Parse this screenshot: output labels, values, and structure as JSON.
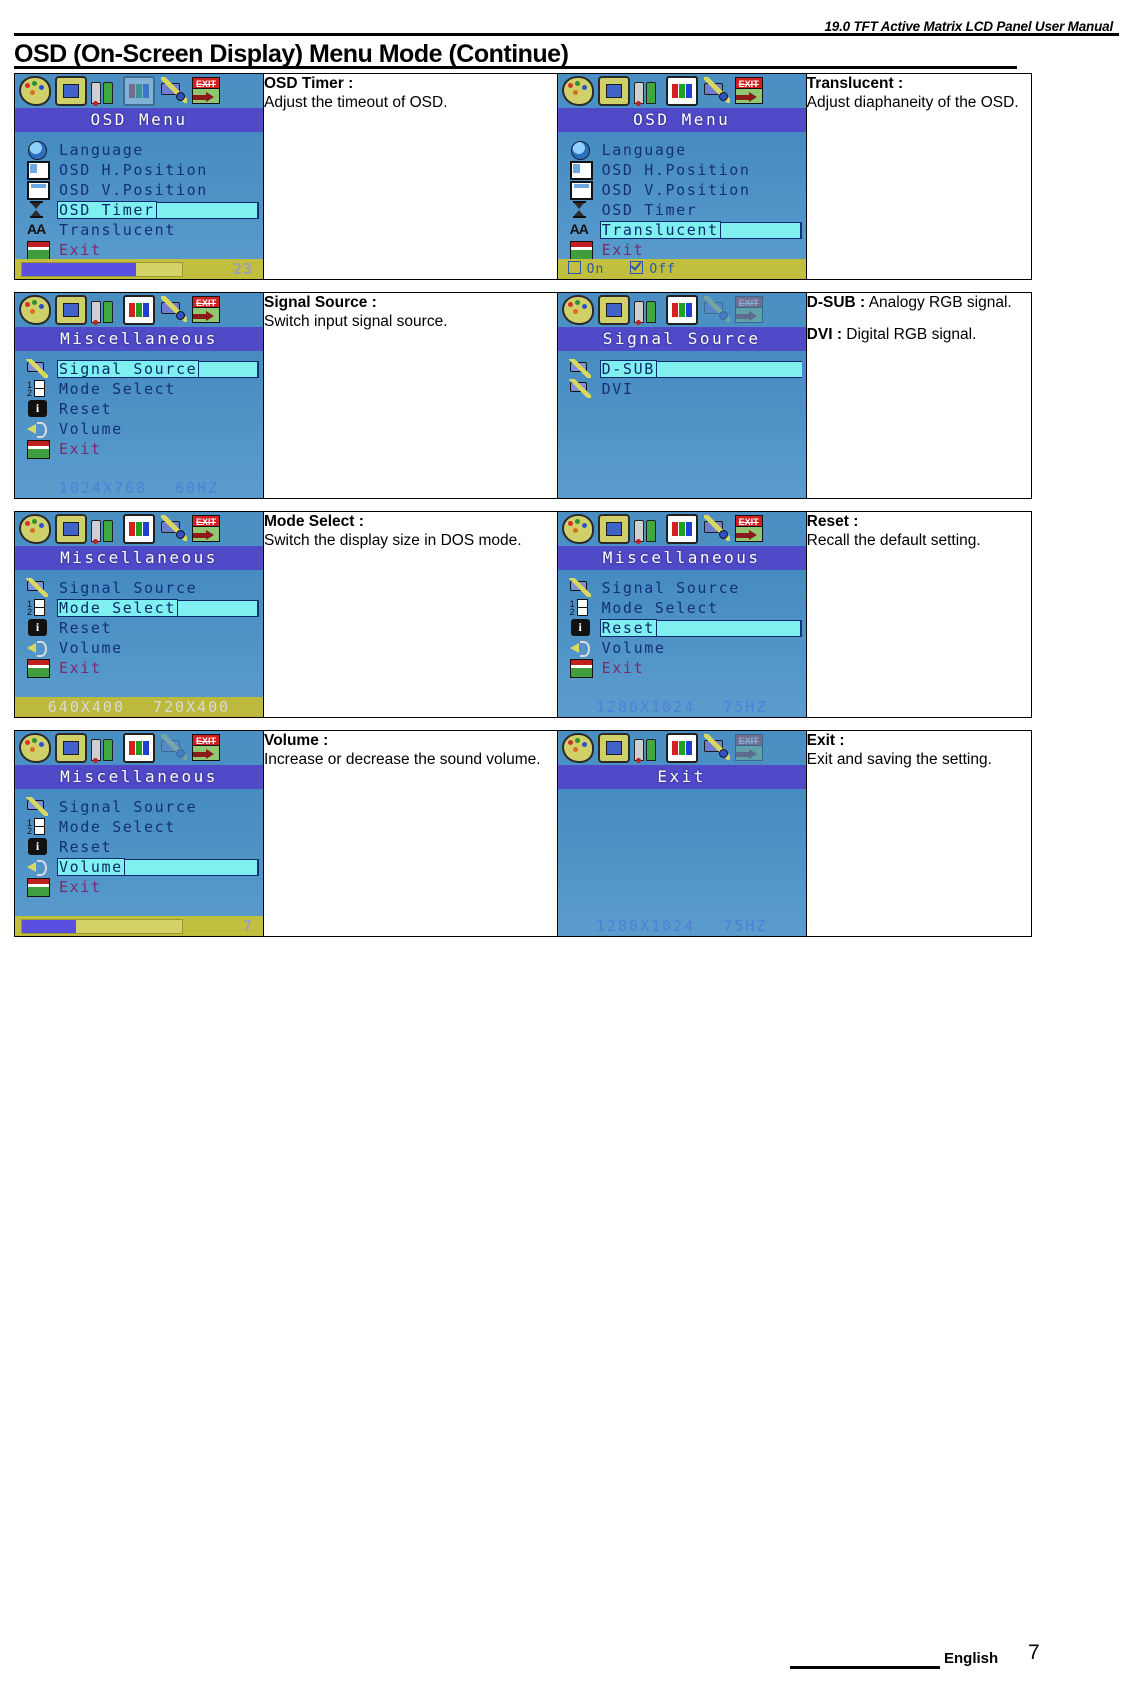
{
  "header": {
    "running_title": "19.0 TFT Active Matrix LCD Panel User Manual",
    "page_title": "OSD (On-Screen Display) Menu Mode (Continue)"
  },
  "footer": {
    "language": "English",
    "page_number": "7"
  },
  "osd_menu_labels": {
    "language": "Language",
    "osd_h_position": "OSD H.Position",
    "osd_v_position": "OSD V.Position",
    "osd_timer": "OSD Timer",
    "translucent": "Translucent",
    "exit": "Exit",
    "signal_source": "Signal Source",
    "mode_select": "Mode Select",
    "reset": "Reset",
    "volume": "Volume",
    "d_sub": "D-SUB",
    "dvi": "DVI"
  },
  "screen_titles": {
    "osd_menu": "OSD Menu",
    "miscellaneous": "Miscellaneous",
    "signal_source": "Signal Source",
    "exit": "Exit"
  },
  "rows": [
    {
      "left": {
        "title": "OSD Menu",
        "selected": "OSD Timer",
        "bottom_type": "progress",
        "progress_percent": 71,
        "value": "23"
      },
      "left_desc": {
        "term": "OSD Timer :",
        "text": "Adjust the timeout of OSD."
      },
      "right": {
        "title": "OSD Menu",
        "selected": "Translucent",
        "bottom_type": "onoff",
        "option_on": "On",
        "option_off": "Off",
        "checked": "Off"
      },
      "right_desc": {
        "term": "Translucent :",
        "text": "Adjust diaphaneity of the OSD."
      }
    },
    {
      "left": {
        "title": "Miscellaneous",
        "selected": "Signal Source",
        "bottom_type": "resolution-blue",
        "resolution": "1024X768",
        "refresh": "60HZ"
      },
      "left_desc": {
        "term": "Signal Source :",
        "text": "Switch input signal source."
      },
      "right": {
        "title": "Signal Source",
        "selected": "D-SUB",
        "bottom_type": "none"
      },
      "right_desc_1": {
        "term": "D-SUB :",
        "text": "Analogy RGB signal."
      },
      "right_desc_2": {
        "term": "DVI :",
        "text": "Digital RGB signal."
      }
    },
    {
      "left": {
        "title": "Miscellaneous",
        "selected": "Mode Select",
        "bottom_type": "resolution-olive",
        "resolution": "640X400",
        "refresh": "720X400"
      },
      "left_desc": {
        "term": "Mode Select :",
        "text": "Switch the display size in DOS mode."
      },
      "right": {
        "title": "Miscellaneous",
        "selected": "Reset",
        "bottom_type": "resolution-blue",
        "resolution": "1280X1024",
        "refresh": "75HZ"
      },
      "right_desc": {
        "term": "Reset :",
        "text": "Recall the default setting."
      }
    },
    {
      "left": {
        "title": "Miscellaneous",
        "selected": "Volume",
        "bottom_type": "progress",
        "progress_percent": 34,
        "value": "7"
      },
      "left_desc": {
        "term": "Volume :",
        "text": "Increase or decrease the sound volume."
      },
      "right": {
        "title": "Exit",
        "selected": "",
        "bottom_type": "resolution-blue",
        "resolution": "1280X1024",
        "refresh": "75HZ"
      },
      "right_desc": {
        "term": "Exit :",
        "text": "Exit and saving the setting."
      }
    }
  ]
}
